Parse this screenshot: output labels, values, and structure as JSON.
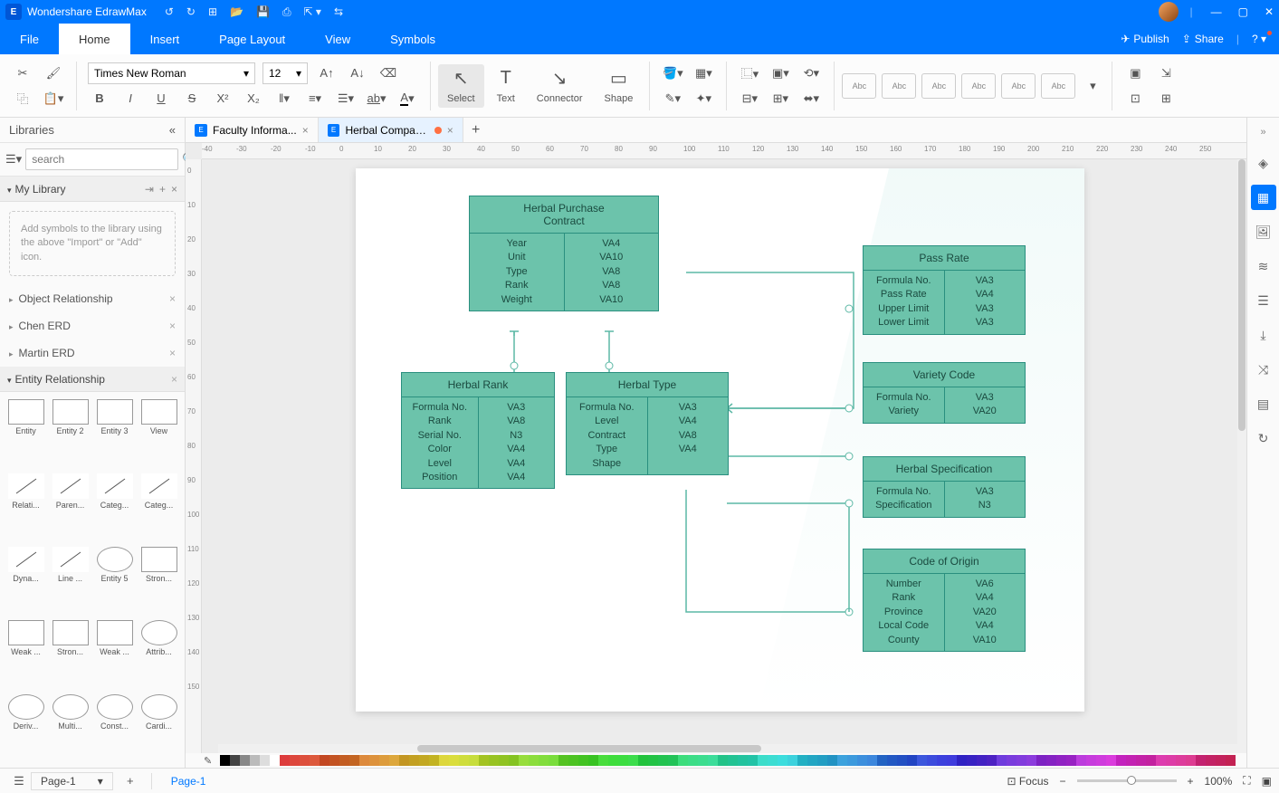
{
  "app": {
    "name": "Wondershare EdrawMax"
  },
  "menu": {
    "items": [
      "File",
      "Home",
      "Insert",
      "Page Layout",
      "View",
      "Symbols"
    ],
    "active": 1,
    "publish": "Publish",
    "share": "Share"
  },
  "toolbar": {
    "font": "Times New Roman",
    "size": "12",
    "tools": {
      "select": "Select",
      "text": "Text",
      "connector": "Connector",
      "shape": "Shape"
    },
    "style_label": "Abc"
  },
  "left": {
    "title": "Libraries",
    "search_placeholder": "search",
    "mylib": "My Library",
    "hint": "Add symbols to the library using the above \"Import\" or \"Add\" icon.",
    "sections": [
      "Object Relationship",
      "Chen ERD",
      "Martin ERD"
    ],
    "er_section": "Entity Relationship",
    "shapes": [
      "Entity",
      "Entity 2",
      "Entity 3",
      "View",
      "Relati...",
      "Paren...",
      "Categ...",
      "Categ...",
      "Dyna...",
      "Line ...",
      "Entity 5",
      "Stron...",
      "Weak ...",
      "Stron...",
      "Weak ...",
      "Attrib...",
      "Deriv...",
      "Multi...",
      "Const...",
      "Cardi..."
    ]
  },
  "tabs": {
    "items": [
      {
        "label": "Faculty Informa...",
        "active": false,
        "modified": false
      },
      {
        "label": "Herbal Compan...",
        "active": true,
        "modified": true
      }
    ]
  },
  "ruler_h": [
    "-40",
    "-30",
    "-20",
    "-10",
    "0",
    "10",
    "20",
    "30",
    "40",
    "50",
    "60",
    "70",
    "80",
    "90",
    "100",
    "110",
    "120",
    "130",
    "140",
    "150",
    "160",
    "170",
    "180",
    "190",
    "200",
    "210",
    "220",
    "230",
    "240",
    "250"
  ],
  "ruler_v": [
    "0",
    "10",
    "20",
    "30",
    "40",
    "50",
    "60",
    "70",
    "80",
    "90",
    "100",
    "110",
    "120",
    "130",
    "140",
    "150"
  ],
  "erd": {
    "t1": {
      "title": "Herbal Purchase\nContract",
      "left": [
        "Year",
        "Unit",
        "Type",
        "Rank",
        "Weight"
      ],
      "right": [
        "VA4",
        "VA10",
        "VA8",
        "VA8",
        "VA10"
      ]
    },
    "t2": {
      "title": "Herbal Rank",
      "left": [
        "Formula No.",
        "Rank",
        "Serial No.",
        "Color",
        "Level",
        "Position"
      ],
      "right": [
        "VA3",
        "VA8",
        "N3",
        "VA4",
        "VA4",
        "VA4"
      ]
    },
    "t3": {
      "title": "Herbal Type",
      "left": [
        "Formula No.",
        "Level",
        "Contract",
        "Type",
        "Shape"
      ],
      "right": [
        "VA3",
        "VA4",
        "VA8",
        "VA4"
      ]
    },
    "t4": {
      "title": "Pass Rate",
      "left": [
        "Formula No.",
        "Pass Rate",
        "Upper Limit",
        "Lower Limit"
      ],
      "right": [
        "VA3",
        "VA4",
        "VA3",
        "VA3"
      ]
    },
    "t5": {
      "title": "Variety Code",
      "left": [
        "Formula No.",
        "Variety"
      ],
      "right": [
        "VA3",
        "VA20"
      ]
    },
    "t6": {
      "title": "Herbal Specification",
      "left": [
        "Formula No.",
        "Specification"
      ],
      "right": [
        "VA3",
        "N3"
      ]
    },
    "t7": {
      "title": "Code of Origin",
      "left": [
        "Number",
        "Rank",
        "Province",
        "Local Code",
        "County"
      ],
      "right": [
        "VA6",
        "VA4",
        "VA20",
        "VA4",
        "VA10"
      ]
    }
  },
  "status": {
    "page_label": "Page-1",
    "page_tab": "Page-1",
    "focus": "Focus",
    "zoom": "100%"
  },
  "colors_accent": "#0078ff"
}
